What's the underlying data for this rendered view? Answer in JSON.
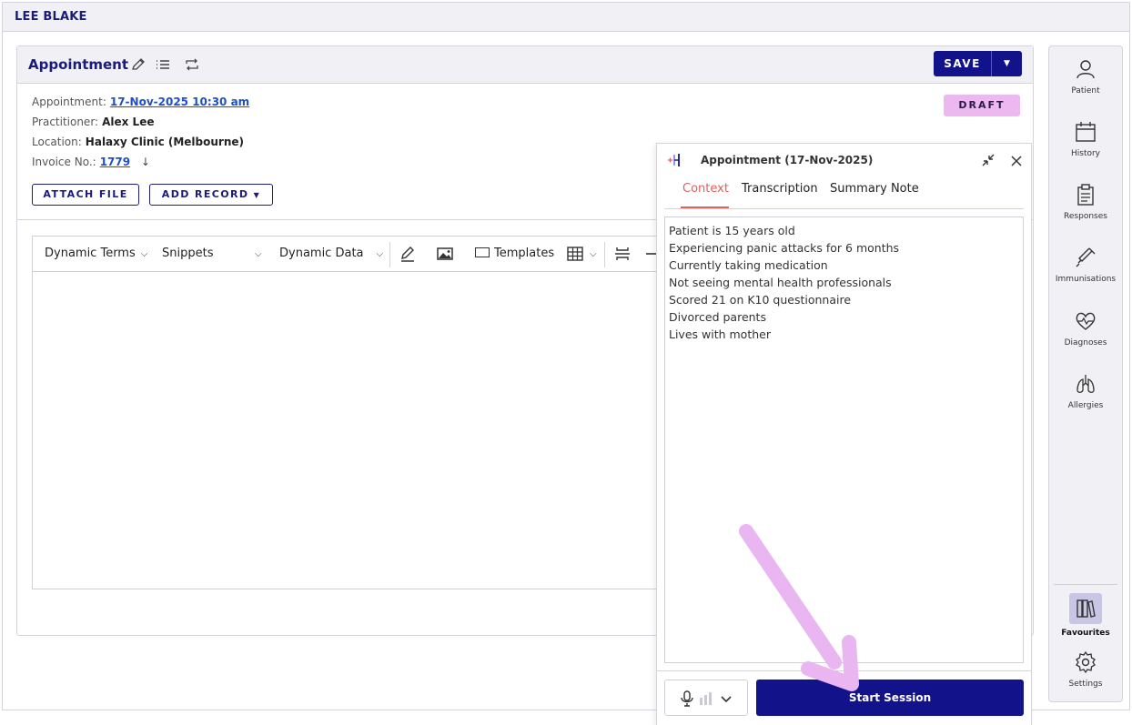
{
  "patient": {
    "name": "LEE BLAKE"
  },
  "appointment": {
    "title": "Appointment",
    "save_label": "SAVE",
    "status": "DRAFT",
    "fields": {
      "appointment_label": "Appointment:",
      "appointment_value": "17-Nov-2025 10:30 am",
      "practitioner_label": "Practitioner:",
      "practitioner_value": "Alex Lee",
      "location_label": "Location:",
      "location_value": "Halaxy Clinic (Melbourne)",
      "invoice_label": "Invoice No.:",
      "invoice_value": "1779"
    },
    "attach_file_label": "ATTACH FILE",
    "add_record_label": "ADD RECORD"
  },
  "editor": {
    "toolbar": {
      "dynamic_terms": "Dynamic Terms",
      "snippets": "Snippets",
      "dynamic_data": "Dynamic Data",
      "templates": "Templates"
    }
  },
  "ai_panel": {
    "title": "Appointment (17-Nov-2025)",
    "tabs": [
      "Context",
      "Transcription",
      "Summary Note"
    ],
    "active_tab": "Context",
    "context_lines": [
      "Patient is 15 years old",
      "Experiencing panic attacks for 6 months",
      "Currently taking medication",
      "Not seeing mental health professionals",
      "Scored 21 on K10 questionnaire",
      "Divorced parents",
      "Lives with mother"
    ],
    "start_session_label": "Start Session"
  },
  "sidebar": {
    "items": [
      {
        "label": "Patient",
        "icon": "person-icon"
      },
      {
        "label": "History",
        "icon": "calendar-icon"
      },
      {
        "label": "Responses",
        "icon": "clipboard-icon"
      },
      {
        "label": "Immunisations",
        "icon": "syringe-icon"
      },
      {
        "label": "Diagnoses",
        "icon": "heart-pulse-icon"
      },
      {
        "label": "Allergies",
        "icon": "lungs-icon"
      }
    ],
    "favourites_label": "Favourites",
    "settings_label": "Settings"
  },
  "colors": {
    "brand_navy": "#12128a",
    "draft_badge": "#edb8f0",
    "active_tab": "#e0605a",
    "annotation_arrow": "#e9b6f2"
  }
}
